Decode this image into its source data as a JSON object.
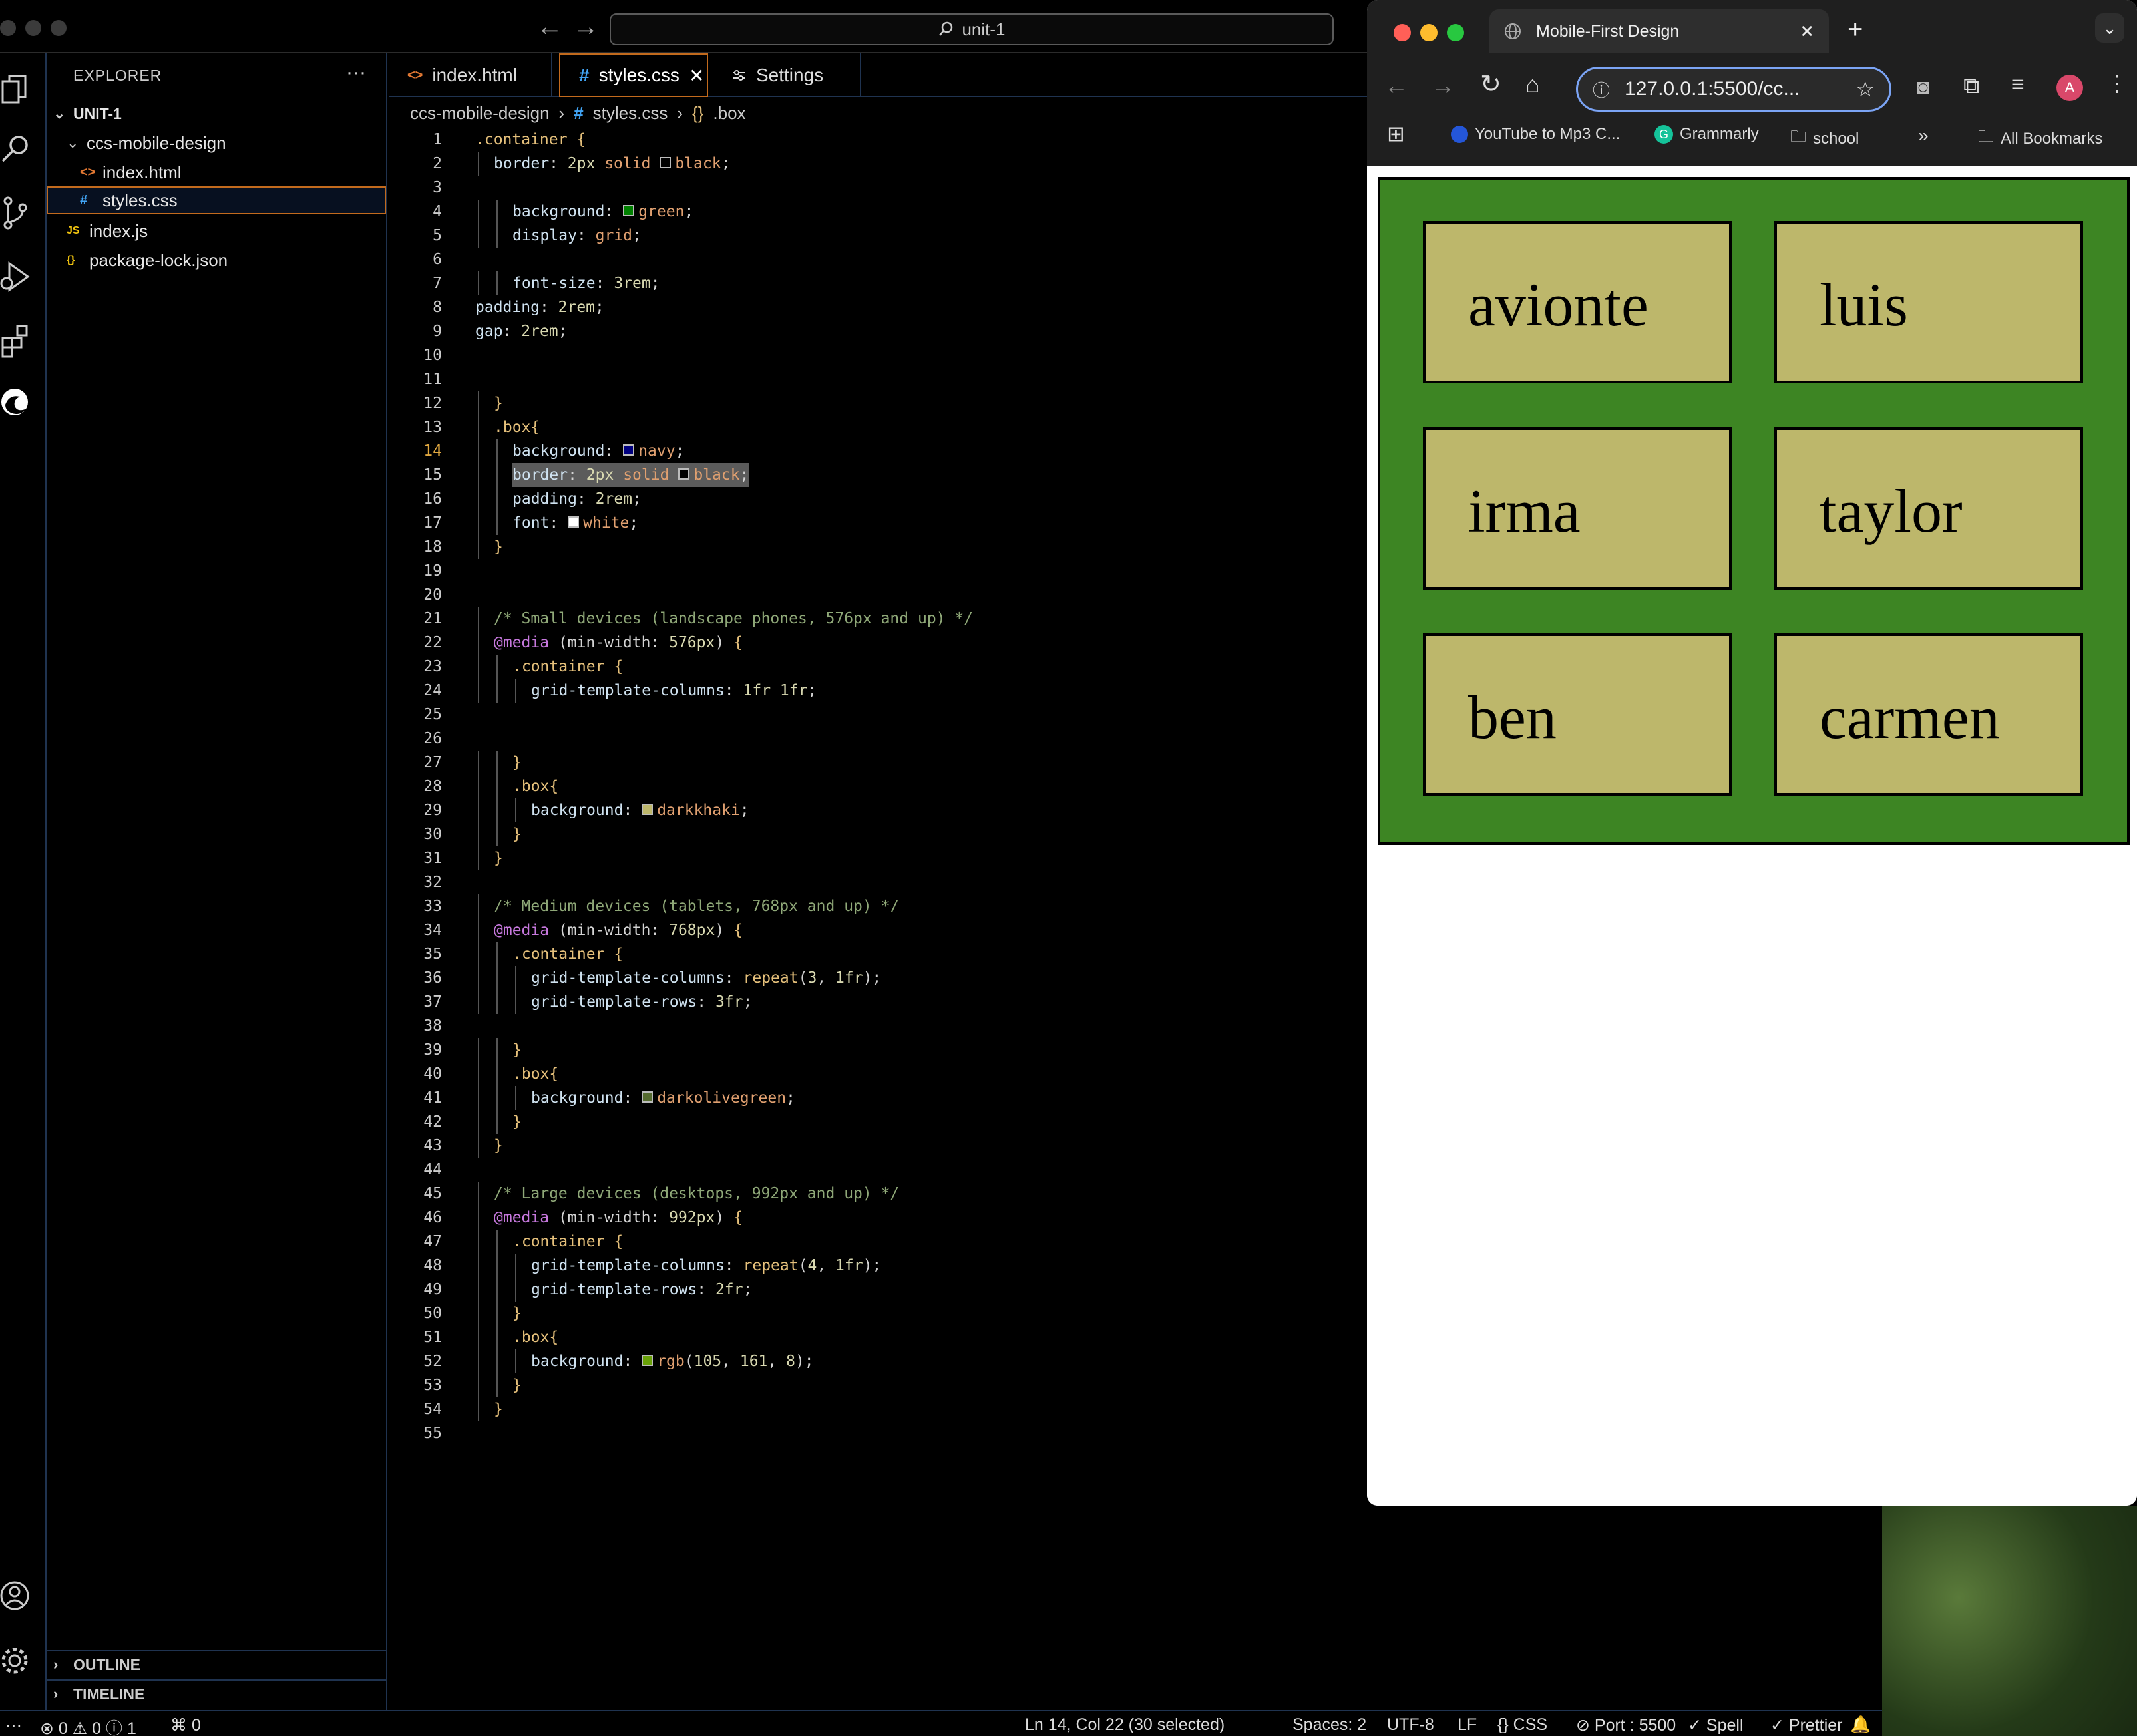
{
  "titlebar": {
    "search_text": "unit-1"
  },
  "explorer": {
    "title": "EXPLORER",
    "root": "UNIT-1",
    "items": [
      {
        "label": "ccs-mobile-design",
        "icon": "folder-chevron"
      },
      {
        "label": "index.html",
        "icon": "<>"
      },
      {
        "label": "styles.css",
        "icon": "#"
      },
      {
        "label": "index.js",
        "icon": "JS"
      },
      {
        "label": "package-lock.json",
        "icon": "{}"
      }
    ],
    "outline": "OUTLINE",
    "timeline": "TIMELINE"
  },
  "tabs": [
    {
      "label": "index.html",
      "icon": "<>"
    },
    {
      "label": "styles.css",
      "icon": "#"
    },
    {
      "label": "Settings",
      "icon": "settings-icon"
    }
  ],
  "breadcrumb": [
    "ccs-mobile-design",
    "styles.css",
    ".box"
  ],
  "code_lines": [
    {
      "n": "1",
      "text": ".container {"
    },
    {
      "n": "2",
      "text": "border: 2px solid black;"
    },
    {
      "n": "3",
      "text": ""
    },
    {
      "n": "4",
      "text": "background: green;"
    },
    {
      "n": "5",
      "text": "display: grid;"
    },
    {
      "n": "6",
      "text": ""
    },
    {
      "n": "7",
      "text": "font-size: 3rem;"
    },
    {
      "n": "8",
      "text": "padding: 2rem;"
    },
    {
      "n": "9",
      "text": "gap: 2rem;"
    },
    {
      "n": "10",
      "text": ""
    },
    {
      "n": "11",
      "text": ""
    },
    {
      "n": "12",
      "text": "}"
    },
    {
      "n": "13",
      "text": ".box{"
    },
    {
      "n": "14",
      "text": "background: navy;"
    },
    {
      "n": "15",
      "text": "border: 2px solid black;"
    },
    {
      "n": "16",
      "text": "padding: 2rem;"
    },
    {
      "n": "17",
      "text": "font: white;"
    },
    {
      "n": "18",
      "text": "}"
    },
    {
      "n": "19",
      "text": ""
    },
    {
      "n": "20",
      "text": ""
    },
    {
      "n": "21",
      "text": "/* Small devices (landscape phones, 576px and up) */"
    },
    {
      "n": "22",
      "text": "@media (min-width: 576px) {"
    },
    {
      "n": "23",
      "text": ".container {"
    },
    {
      "n": "24",
      "text": "grid-template-columns: 1fr 1fr;"
    },
    {
      "n": "25",
      "text": ""
    },
    {
      "n": "26",
      "text": ""
    },
    {
      "n": "27",
      "text": "}"
    },
    {
      "n": "28",
      "text": ".box{"
    },
    {
      "n": "29",
      "text": "background: darkkhaki;"
    },
    {
      "n": "30",
      "text": "}"
    },
    {
      "n": "31",
      "text": "}"
    },
    {
      "n": "32",
      "text": ""
    },
    {
      "n": "33",
      "text": "/* Medium devices (tablets, 768px and up) */"
    },
    {
      "n": "34",
      "text": "@media (min-width: 768px) {"
    },
    {
      "n": "35",
      "text": ".container {"
    },
    {
      "n": "36",
      "text": "grid-template-columns: repeat(3, 1fr);"
    },
    {
      "n": "37",
      "text": "grid-template-rows: 3fr;"
    },
    {
      "n": "38",
      "text": ""
    },
    {
      "n": "39",
      "text": "}"
    },
    {
      "n": "40",
      "text": ".box{"
    },
    {
      "n": "41",
      "text": "background: darkolivegreen;"
    },
    {
      "n": "42",
      "text": "}"
    },
    {
      "n": "43",
      "text": "}"
    },
    {
      "n": "44",
      "text": ""
    },
    {
      "n": "45",
      "text": "/* Large devices (desktops, 992px and up) */"
    },
    {
      "n": "46",
      "text": "@media (min-width: 992px) {"
    },
    {
      "n": "47",
      "text": ".container {"
    },
    {
      "n": "48",
      "text": "grid-template-columns: repeat(4, 1fr);"
    },
    {
      "n": "49",
      "text": "grid-template-rows: 2fr;"
    },
    {
      "n": "50",
      "text": "}"
    },
    {
      "n": "51",
      "text": ".box{"
    },
    {
      "n": "52",
      "text": "background: rgb(105, 161, 8);"
    },
    {
      "n": "53",
      "text": "}"
    },
    {
      "n": "54",
      "text": "}"
    },
    {
      "n": "55",
      "text": ""
    }
  ],
  "statusbar": {
    "problems": "0",
    "warnings": "0",
    "info": "1",
    "ports": "0",
    "position": "Ln 14, Col 22 (30 selected)",
    "spaces": "Spaces: 2",
    "encoding": "UTF-8",
    "eol": "LF",
    "language": "CSS",
    "port": "Port : 5500",
    "spell": "Spell",
    "prettier": "Prettier"
  },
  "browser": {
    "tab_title": "Mobile-First Design",
    "url": "127.0.0.1:5500/cc...",
    "profile_initial": "A",
    "bookmarks": [
      "YouTube to Mp3 C...",
      "Grammarly",
      "school"
    ],
    "all_bookmarks": "All Bookmarks",
    "boxes": [
      "avionte",
      "luis",
      "irma",
      "taylor",
      "ben",
      "carmen"
    ],
    "colors": {
      "container": "#3d8523",
      "box": "#bdb76b"
    }
  }
}
